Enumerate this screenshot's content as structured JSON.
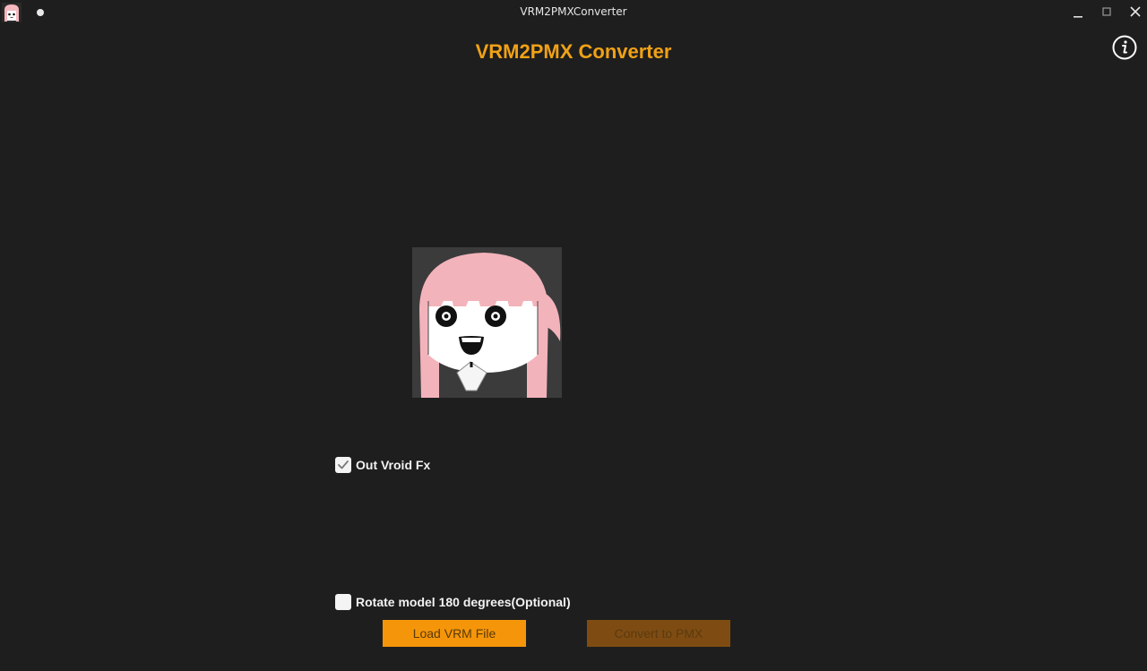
{
  "window": {
    "title": "VRM2PMXConverter"
  },
  "header": {
    "title": "VRM2PMX Converter",
    "accent_color": "#f0a116"
  },
  "icons": {
    "app": "anime-girl-app-icon",
    "indicator": "dot-icon",
    "minimize": "minimize-icon",
    "maximize": "maximize-icon",
    "close": "close-icon",
    "info": "info-icon"
  },
  "options": {
    "out_vroid_fx": {
      "label": "Out Vroid Fx",
      "checked": true
    },
    "rotate_model": {
      "label": "Rotate model 180 degrees(Optional)",
      "checked": false
    }
  },
  "buttons": {
    "load": "Load VRM File",
    "convert": "Convert to PMX",
    "load_color": "#f5960a",
    "convert_color": "#7e4c12"
  }
}
